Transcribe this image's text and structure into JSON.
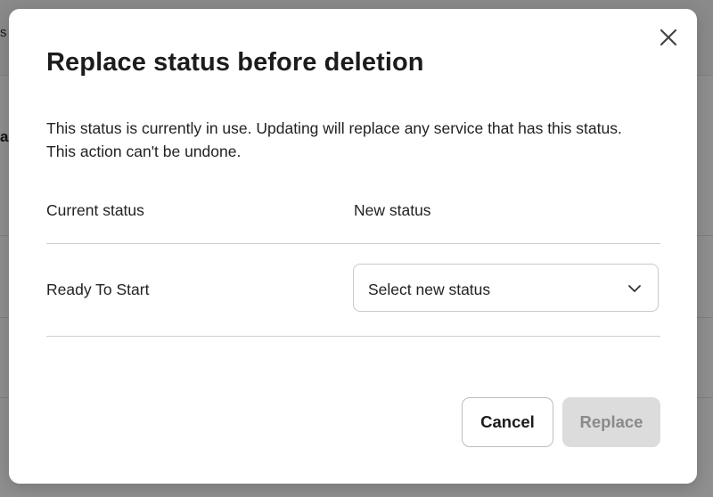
{
  "background": {
    "fragment_top": "s",
    "fragment_left": "a"
  },
  "modal": {
    "title": "Replace status before deletion",
    "description": "This status is currently in use. Updating will replace any service that has this status. This action can't be undone.",
    "close_icon": "close-icon",
    "columns": {
      "current_header": "Current status",
      "new_header": "New status"
    },
    "current_status_value": "Ready To Start",
    "new_status_select": {
      "placeholder": "Select new status",
      "icon": "chevron-down-icon"
    },
    "buttons": {
      "cancel_label": "Cancel",
      "replace_label": "Replace",
      "replace_disabled": true
    }
  },
  "colors": {
    "overlay": "#8f8f8f",
    "title_text": "#1c1c1c",
    "disabled_button_bg": "#dcdcdc",
    "disabled_button_text": "#8a8a8a"
  }
}
